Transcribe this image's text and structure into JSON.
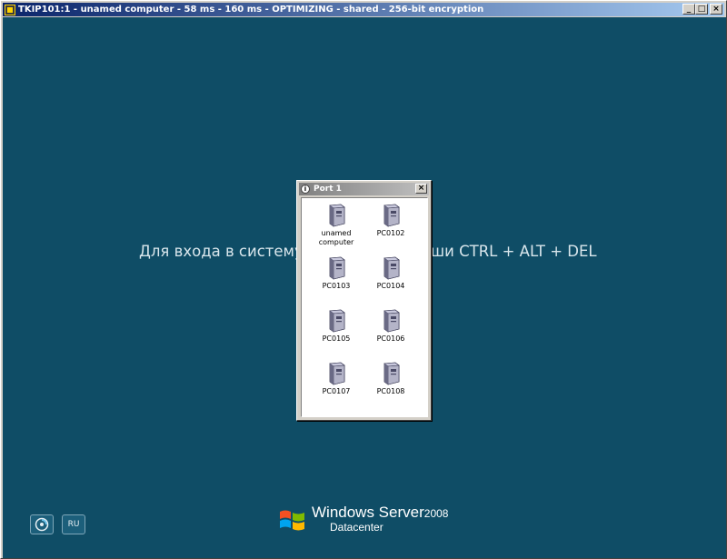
{
  "window": {
    "title": "TKIP101:1 - unamed computer - 58 ms - 160 ms - OPTIMIZING - shared - 256-bit encryption",
    "minimize_symbol": "_",
    "restore_symbol": "□",
    "close_symbol": "×",
    "app_icon": "remote-control-icon"
  },
  "desktop": {
    "background": "#0f4d66",
    "logon_message": "Для входа в систему нажмите клавиши CTRL + ALT + DEL",
    "language_button": "RU",
    "ease_of_access_icon": "ease-of-access-icon",
    "brand": {
      "line1": "Windows Server",
      "version": "2008",
      "line2": "Datacenter"
    }
  },
  "port_dialog": {
    "title": "Port 1",
    "close_symbol": "×",
    "computers": [
      {
        "label_line1": "unamed",
        "label_line2": "computer",
        "icon": "computer-tower-icon"
      },
      {
        "label_line1": "PC0102",
        "label_line2": "",
        "icon": "computer-tower-icon"
      },
      {
        "label_line1": "PC0103",
        "label_line2": "",
        "icon": "computer-tower-icon"
      },
      {
        "label_line1": "PC0104",
        "label_line2": "",
        "icon": "computer-tower-icon"
      },
      {
        "label_line1": "PC0105",
        "label_line2": "",
        "icon": "computer-tower-icon"
      },
      {
        "label_line1": "PC0106",
        "label_line2": "",
        "icon": "computer-tower-icon"
      },
      {
        "label_line1": "PC0107",
        "label_line2": "",
        "icon": "computer-tower-icon"
      },
      {
        "label_line1": "PC0108",
        "label_line2": "",
        "icon": "computer-tower-icon"
      }
    ]
  }
}
